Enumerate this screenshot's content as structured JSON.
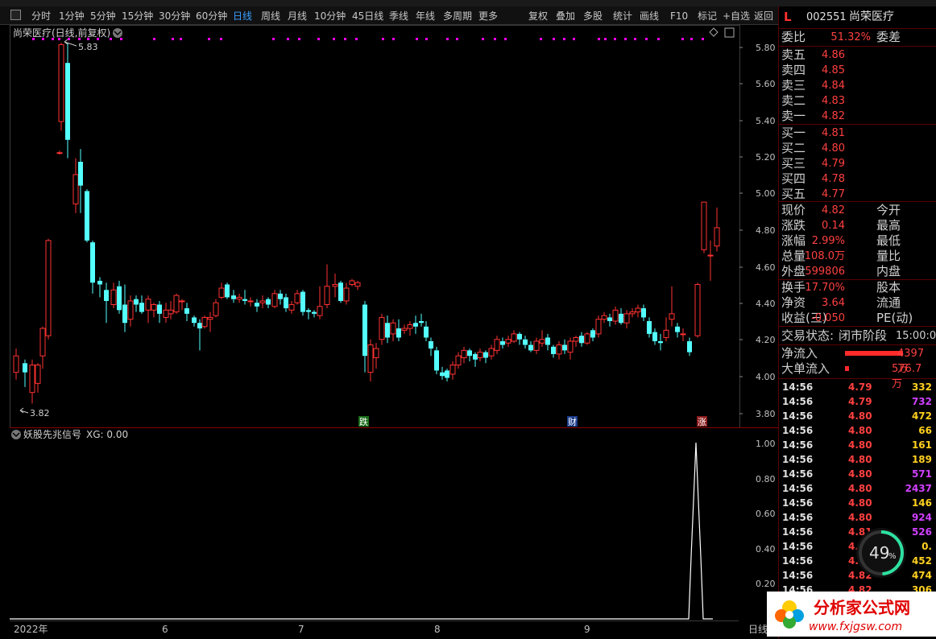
{
  "toolbar": {
    "periods": [
      "分时",
      "1分钟",
      "5分钟",
      "15分钟",
      "30分钟",
      "60分钟",
      "日线",
      "周线",
      "月线",
      "10分钟",
      "45日线",
      "季线",
      "年线",
      "多周期",
      "更多"
    ],
    "active_period": "日线",
    "tools": [
      "复权",
      "叠加",
      "多股",
      "统计",
      "画线",
      "F10",
      "标记",
      "+自选",
      "返回"
    ]
  },
  "chart": {
    "title": "尚荣医疗(日线,前复权)",
    "high_mark": "5.83",
    "low_mark": "3.82",
    "y_ticks": [
      "5.80",
      "5.60",
      "5.40",
      "5.20",
      "5.00",
      "4.80",
      "4.60",
      "4.40",
      "4.20",
      "4.00",
      "3.80"
    ],
    "badges": [
      "跌",
      "财",
      "涨"
    ],
    "colors": {
      "up": "#ff3232",
      "down": "#54ffff",
      "magenta": "#ff00ff"
    }
  },
  "indicator": {
    "name": "妖股先兆信号",
    "value_label": "XG: 0.00",
    "y_ticks": [
      "1.00",
      "0.80",
      "0.60",
      "0.40",
      "0.20"
    ]
  },
  "xaxis": {
    "labels": [
      "2022年",
      "6",
      "7",
      "8",
      "9"
    ],
    "period_label": "日线"
  },
  "quote": {
    "flag": "L",
    "code": "002551",
    "name": "尚荣医疗",
    "weibi_label": "委比",
    "weibi": "51.32%",
    "weicha_label": "委差",
    "asks": [
      {
        "label": "卖五",
        "price": "4.86"
      },
      {
        "label": "卖四",
        "price": "4.85"
      },
      {
        "label": "卖三",
        "price": "4.84"
      },
      {
        "label": "卖二",
        "price": "4.83"
      },
      {
        "label": "卖一",
        "price": "4.82"
      }
    ],
    "bids": [
      {
        "label": "买一",
        "price": "4.81"
      },
      {
        "label": "买二",
        "price": "4.80"
      },
      {
        "label": "买三",
        "price": "4.79"
      },
      {
        "label": "买四",
        "price": "4.78"
      },
      {
        "label": "买五",
        "price": "4.77"
      }
    ],
    "stats1": [
      {
        "label": "现价",
        "value": "4.82",
        "right": "今开"
      },
      {
        "label": "涨跌",
        "value": "0.14",
        "right": "最高"
      },
      {
        "label": "涨幅",
        "value": "2.99%",
        "right": "最低"
      },
      {
        "label": "总量",
        "value": "108.0万",
        "right": "量比"
      },
      {
        "label": "外盘",
        "value": "599806",
        "right": "内盘"
      }
    ],
    "stats2": [
      {
        "label": "换手",
        "value": "17.70%",
        "right": "股本"
      },
      {
        "label": "净资",
        "value": "3.64",
        "right": "流通"
      },
      {
        "label": "收益(三)",
        "value": "-0.050",
        "right": "PE(动)"
      }
    ],
    "status_label": "交易状态:",
    "status_value": "闭市阶段",
    "status_time": "15:00:0",
    "netflow_label": "净流入",
    "netflow_value": "4397万",
    "bigflow_label": "大单流入",
    "bigflow_value": "576.7万"
  },
  "trades": [
    {
      "time": "14:56",
      "price": "4.79",
      "vol": "332",
      "color": "#ffd020"
    },
    {
      "time": "14:56",
      "price": "4.79",
      "vol": "732",
      "color": "#d040ff"
    },
    {
      "time": "14:56",
      "price": "4.80",
      "vol": "472",
      "color": "#ffd020"
    },
    {
      "time": "14:56",
      "price": "4.80",
      "vol": "66",
      "color": "#ffd020"
    },
    {
      "time": "14:56",
      "price": "4.80",
      "vol": "161",
      "color": "#ffd020"
    },
    {
      "time": "14:56",
      "price": "4.80",
      "vol": "189",
      "color": "#ffd020"
    },
    {
      "time": "14:56",
      "price": "4.80",
      "vol": "571",
      "color": "#d040ff"
    },
    {
      "time": "14:56",
      "price": "4.80",
      "vol": "2437",
      "color": "#d040ff"
    },
    {
      "time": "14:56",
      "price": "4.80",
      "vol": "146",
      "color": "#ffd020"
    },
    {
      "time": "14:56",
      "price": "4.80",
      "vol": "924",
      "color": "#d040ff"
    },
    {
      "time": "14:56",
      "price": "4.81",
      "vol": "526",
      "color": "#d040ff"
    },
    {
      "time": "14:56",
      "price": "4.8",
      "vol": "0.",
      "color": "#ffd020"
    },
    {
      "time": "14:56",
      "price": "4.8",
      "vol": "452",
      "color": "#ffd020"
    },
    {
      "time": "14:56",
      "price": "4.82",
      "vol": "474",
      "color": "#ffd020"
    },
    {
      "time": "14:56",
      "price": "4.82",
      "vol": "306",
      "color": "#ffd020"
    }
  ],
  "gauge": {
    "value": "49",
    "unit": "%"
  },
  "watermark": {
    "cn": "分析家公式网",
    "url": "www.fxjgsw.com"
  }
}
